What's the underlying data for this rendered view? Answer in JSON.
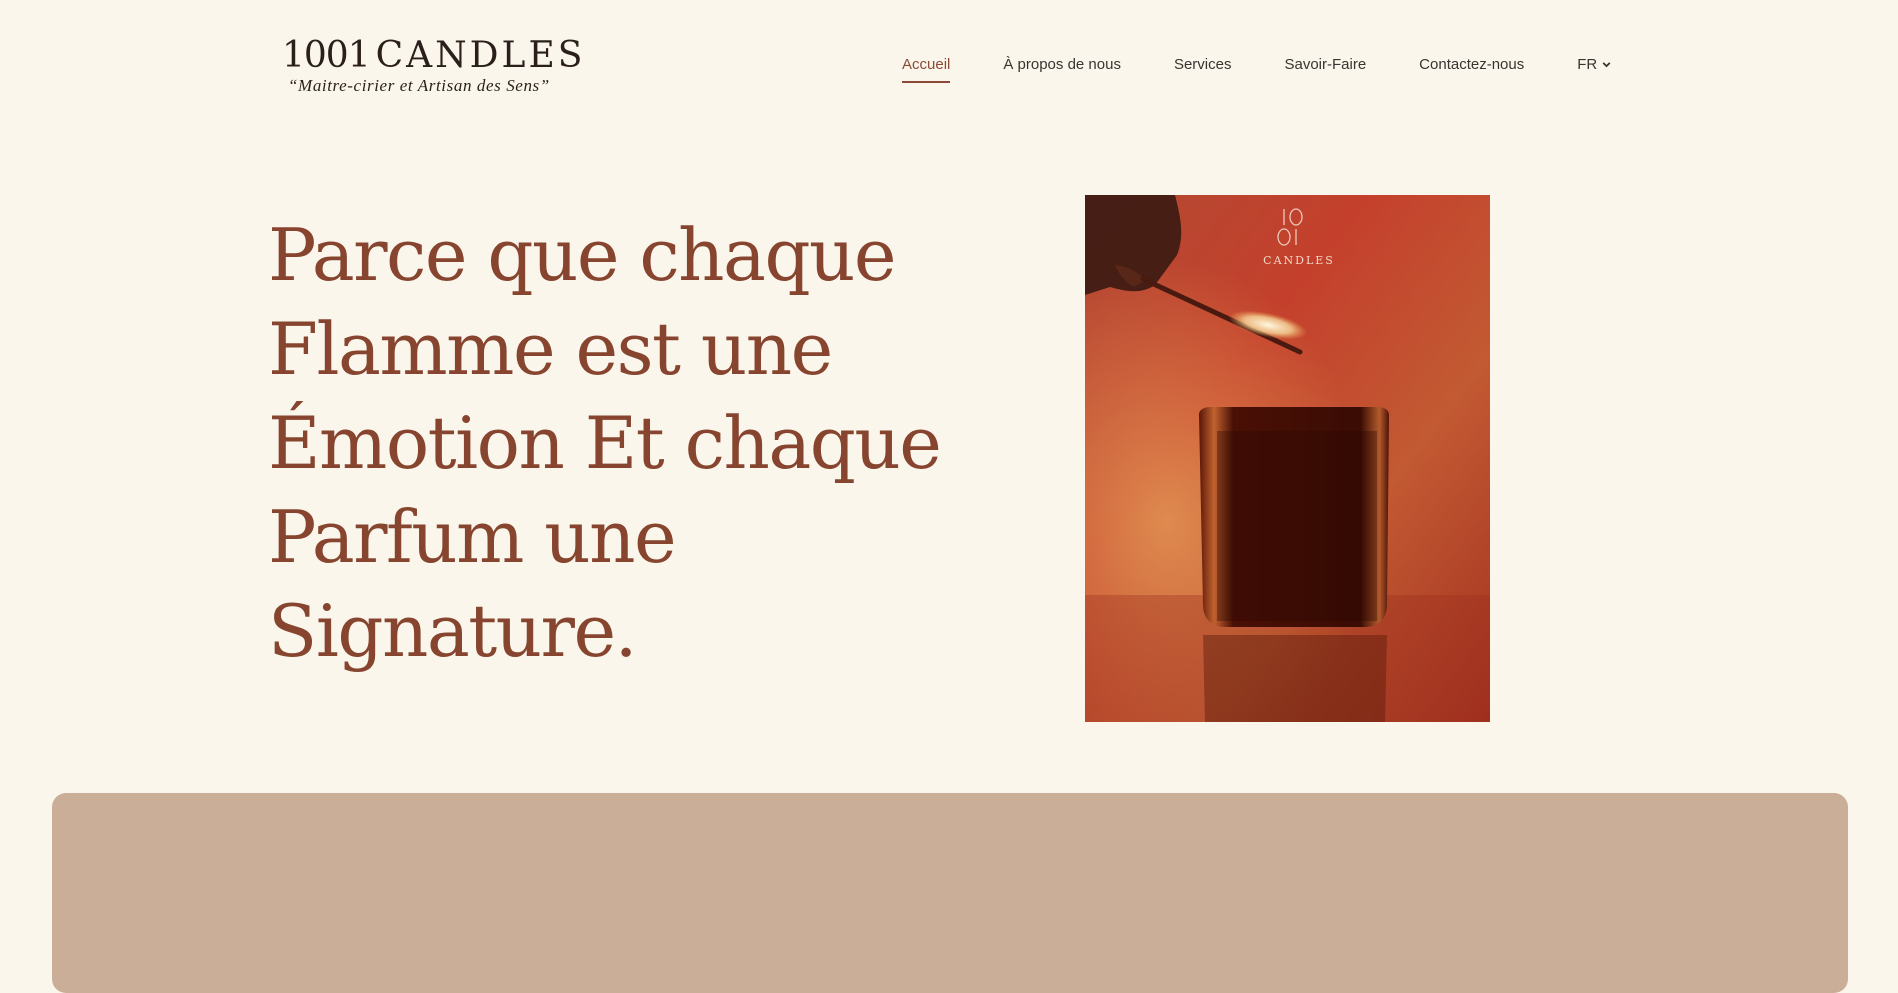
{
  "brand": {
    "logo_number": "1001",
    "logo_name": "CANDLES",
    "tagline": "“Maitre-cirier et Artisan des Sens”"
  },
  "nav": {
    "items": [
      {
        "label": "Accueil",
        "active": true
      },
      {
        "label": "À propos de nous",
        "active": false
      },
      {
        "label": "Services",
        "active": false
      },
      {
        "label": "Savoir-Faire",
        "active": false
      },
      {
        "label": "Contactez-nous",
        "active": false
      }
    ],
    "language": "FR"
  },
  "hero": {
    "title": "Parce que chaque Flamme est une Émotion Et chaque Parfum une Signature.",
    "image": {
      "logo_number_top": "10",
      "logo_number_bottom": "01",
      "logo_name": "CANDLES"
    }
  },
  "colors": {
    "background": "#faf6ec",
    "accent": "#87452f",
    "panel": "#cbae98"
  }
}
